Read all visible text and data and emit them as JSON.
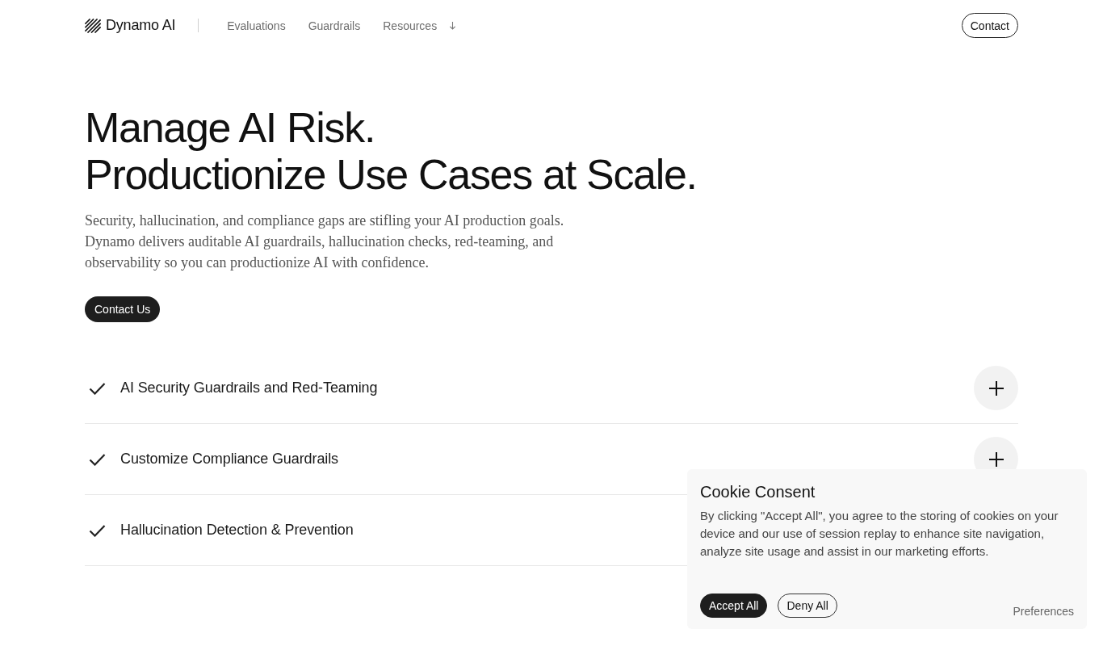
{
  "header": {
    "logo": "Dynamo AI",
    "nav": [
      {
        "label": "Evaluations",
        "dropdown": false
      },
      {
        "label": "Guardrails",
        "dropdown": false
      },
      {
        "label": "Resources",
        "dropdown": true
      }
    ],
    "contact_button": "Contact"
  },
  "hero": {
    "heading_lines": [
      "Manage AI Risk.",
      "Productionize Use Cases at Scale."
    ],
    "description": "Security, hallucination, and compliance gaps are stifling your AI production goals. Dynamo delivers auditable AI guardrails, hallucination checks, red-teaming, and observability so you can productionize AI with confidence.",
    "cta": "Contact Us"
  },
  "features": [
    {
      "title": "AI Security Guardrails and Red-Teaming",
      "expanded": false
    },
    {
      "title": "Customize Compliance Guardrails",
      "expanded": false
    },
    {
      "title": "Hallucination Detection & Prevention"
    }
  ],
  "cookie_consent": {
    "title": "Cookie Consent",
    "text": "By clicking \"Accept All\", you agree to the storing of cookies on your device and our use of session replay to enhance site navigation, analyze site usage and assist in our marketing efforts.",
    "buttons": [
      {
        "label": "Accept All",
        "kind": "primary"
      },
      {
        "label": "Deny All",
        "kind": "secondary"
      }
    ],
    "preferences": "Preferences"
  }
}
